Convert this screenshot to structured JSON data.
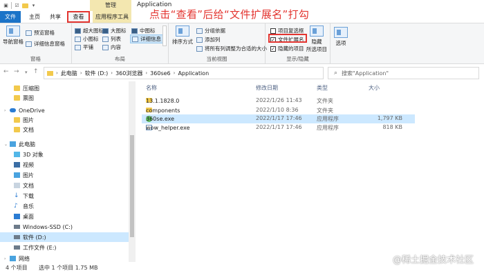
{
  "window": {
    "title": "Application",
    "context_tab_header": "管理",
    "annotation": "点击“查看”后给“文件扩展名”打勾"
  },
  "tabs": {
    "file": "文件",
    "home": "主页",
    "share": "共享",
    "view": "查看",
    "app_tools": "应用程序工具"
  },
  "ribbon": {
    "pane": {
      "nav_pane": "导航窗格",
      "preview_pane": "预览窗格",
      "details_pane": "详细信息窗格",
      "label": "窗格"
    },
    "layout": {
      "extra_large": "超大图标",
      "large": "大图标",
      "medium": "中图标",
      "small": "小图标",
      "list": "列表",
      "details": "详细信息",
      "tiles": "平铺",
      "content": "内容",
      "label": "布局"
    },
    "current_view": {
      "sort_by": "排序方式",
      "group_by": "分组依据",
      "add_columns": "添加列",
      "size_all_columns": "将所有列调整为合适的大小",
      "label": "当前视图"
    },
    "show_hide": {
      "item_checkboxes": "项目复选框",
      "item_checkboxes_checked": false,
      "file_extensions": "文件扩展名",
      "file_extensions_checked": true,
      "hidden_items": "隐藏的项目",
      "hidden_items_checked": true,
      "hide_selected_line1": "隐藏",
      "hide_selected_line2": "所选项目",
      "label": "显示/隐藏"
    },
    "options": "选项"
  },
  "address": {
    "crumbs": [
      "此电脑",
      "软件 (D:)",
      "360浏览器",
      "360se6",
      "Application"
    ],
    "search_placeholder": "搜索\"Application\""
  },
  "nav": {
    "items": [
      {
        "label": "压缩图",
        "icon": "folder-icon"
      },
      {
        "label": "票图",
        "icon": "folder-icon"
      },
      {
        "label": "OneDrive",
        "icon": "onedrive-icon"
      },
      {
        "label": "图片",
        "icon": "folder-icon"
      },
      {
        "label": "文档",
        "icon": "folder-icon"
      },
      {
        "label": "此电脑",
        "icon": "pc-icon"
      },
      {
        "label": "3D 对象",
        "icon": "3d-objects-icon"
      },
      {
        "label": "视频",
        "icon": "video-icon"
      },
      {
        "label": "图片",
        "icon": "pictures-icon"
      },
      {
        "label": "文档",
        "icon": "documents-icon"
      },
      {
        "label": "下载",
        "icon": "download-icon"
      },
      {
        "label": "音乐",
        "icon": "music-icon"
      },
      {
        "label": "桌面",
        "icon": "desktop-icon"
      },
      {
        "label": "Windows-SSD (C:)",
        "icon": "drive-icon"
      },
      {
        "label": "软件 (D:)",
        "icon": "drive-icon"
      },
      {
        "label": "工作文件 (E:)",
        "icon": "drive-icon"
      },
      {
        "label": "网络",
        "icon": "network-icon"
      }
    ]
  },
  "filelist": {
    "columns": {
      "name": "名称",
      "date": "修改日期",
      "type": "类型",
      "size": "大小"
    },
    "rows": [
      {
        "name": "13.1.1828.0",
        "date": "2022/1/26 11:43",
        "type": "文件夹",
        "size": "",
        "icon": "folder-icon"
      },
      {
        "name": "components",
        "date": "2022/1/10 8:36",
        "type": "文件夹",
        "size": "",
        "icon": "folder-icon"
      },
      {
        "name": "360se.exe",
        "date": "2022/1/17 17:46",
        "type": "应用程序",
        "size": "1,797 KB",
        "icon": "360-browser-icon"
      },
      {
        "name": "wow_helper.exe",
        "date": "2022/1/17 17:46",
        "type": "应用程序",
        "size": "818 KB",
        "icon": "exe-icon"
      }
    ]
  },
  "status": {
    "count": "4 个项目",
    "selected": "选中 1 个项目  1.75 MB"
  },
  "watermark": "@稀土掘金技术社区",
  "colors": {
    "accent": "#1a73c8",
    "highlight": "#e3342f",
    "selection": "#cce8ff",
    "context_tab": "#f3e7b0"
  }
}
